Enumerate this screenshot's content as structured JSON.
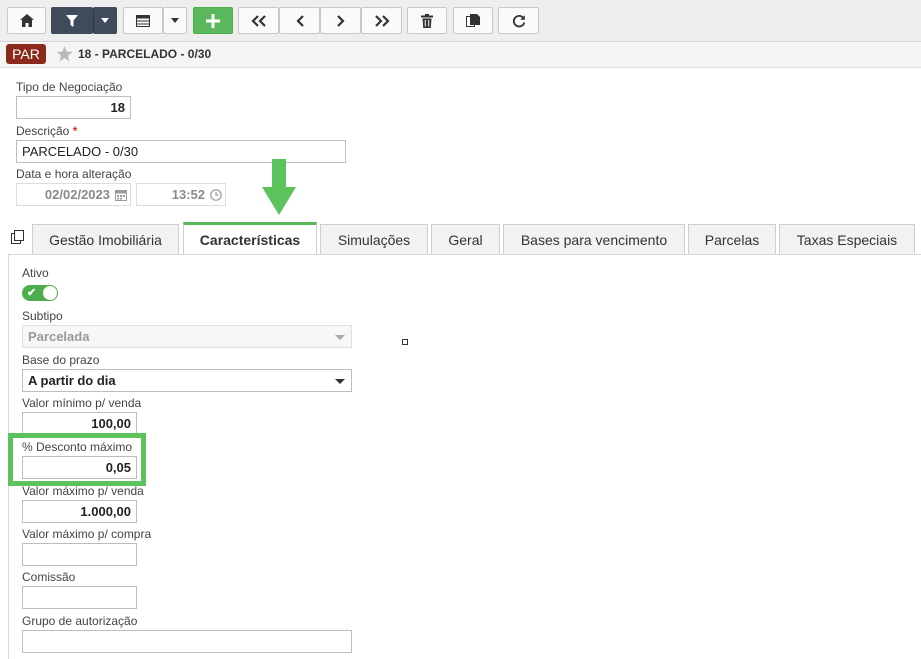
{
  "toolbar": {
    "icons": [
      "home-icon",
      "filter-icon",
      "chevron-down-icon",
      "list-icon",
      "chevron-down-icon",
      "plus-icon",
      "double-chevron-left-icon",
      "chevron-left-icon",
      "chevron-right-icon",
      "double-chevron-right-icon",
      "trash-icon",
      "copy-icon",
      "refresh-icon"
    ]
  },
  "header": {
    "badge": "PAR",
    "title": "18 - PARCELADO - 0/30"
  },
  "form": {
    "tipo_label": "Tipo de Negociação",
    "tipo_value": "18",
    "descricao_label": "Descrição",
    "descricao_required": "*",
    "descricao_value": "PARCELADO - 0/30",
    "data_label": "Data e hora alteração",
    "data_value": "02/02/2023",
    "hora_value": "13:52"
  },
  "tabs": [
    "Gestão Imobiliária",
    "Características",
    "Simulações",
    "Geral",
    "Bases para vencimento",
    "Parcelas",
    "Taxas Especiais"
  ],
  "active_tab": "Características",
  "caract": {
    "ativo_label": "Ativo",
    "ativo_on": true,
    "check_mark": "✔",
    "subtipo_label": "Subtipo",
    "subtipo_value": "Parcelada",
    "base_label": "Base do prazo",
    "base_value": "A partir do dia",
    "vmin_label": "Valor mínimo p/ venda",
    "vmin_value": "100,00",
    "desc_label": "% Desconto máximo",
    "desc_value": "0,05",
    "vmax_label": "Valor máximo p/ venda",
    "vmax_value": "1.000,00",
    "vmaxc_label": "Valor máximo p/ compra",
    "vmaxc_value": "",
    "comissao_label": "Comissão",
    "comissao_value": "",
    "grupo_label": "Grupo de autorização",
    "grupo_value": ""
  },
  "colors": {
    "accent": "#5cb85c",
    "badge": "#8b2a1c",
    "highlight": "#5cc35c"
  }
}
